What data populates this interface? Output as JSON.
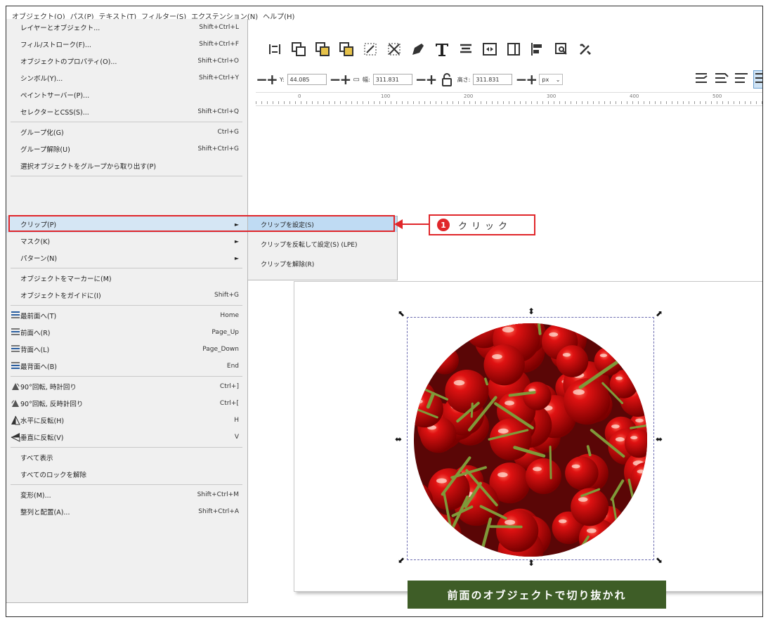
{
  "menubar": [
    "オブジェクト(O)",
    "パス(P)",
    "テキスト(T)",
    "フィルター(S)",
    "エクステンション(N)",
    "ヘルプ(H)"
  ],
  "controls": {
    "y_label": "Y:",
    "y_value": "44.085",
    "w_label": "幅:",
    "w_value": "311.831",
    "h_label": "高さ:",
    "h_value": "311.831",
    "unit": "px"
  },
  "ruler_ticks": [
    "0",
    "100",
    "200",
    "300",
    "400",
    "500"
  ],
  "menu": {
    "items": [
      {
        "label": "レイヤーとオブジェクト...",
        "shortcut": "Shift+Ctrl+L"
      },
      {
        "label": "フィル/ストローク(F)...",
        "shortcut": "Shift+Ctrl+F"
      },
      {
        "label": "オブジェクトのプロパティ(O)...",
        "shortcut": "Shift+Ctrl+O"
      },
      {
        "label": "シンボル(Y)...",
        "shortcut": "Shift+Ctrl+Y"
      },
      {
        "label": "ペイントサーバー(P)...",
        "shortcut": ""
      },
      {
        "label": "セレクターとCSS(S)...",
        "shortcut": "Shift+Ctrl+Q"
      },
      {
        "label": "グループ化(G)",
        "shortcut": "Ctrl+G"
      },
      {
        "label": "グループ解除(U)",
        "shortcut": "Shift+Ctrl+G"
      },
      {
        "label": "選択オブジェクトをグループから取り出す(P)",
        "shortcut": ""
      },
      {
        "label": "クリップ(P)",
        "shortcut": ""
      },
      {
        "label": "マスク(K)",
        "shortcut": ""
      },
      {
        "label": "パターン(N)",
        "shortcut": ""
      },
      {
        "label": "オブジェクトをマーカーに(M)",
        "shortcut": ""
      },
      {
        "label": "オブジェクトをガイドに(I)",
        "shortcut": "Shift+G"
      },
      {
        "label": "最前面へ(T)",
        "shortcut": "Home"
      },
      {
        "label": "前面へ(R)",
        "shortcut": "Page_Up"
      },
      {
        "label": "背面へ(L)",
        "shortcut": "Page_Down"
      },
      {
        "label": "最背面へ(B)",
        "shortcut": "End"
      },
      {
        "label": "90°回転, 時計回り",
        "shortcut": "Ctrl+]"
      },
      {
        "label": "90°回転, 反時計回り",
        "shortcut": "Ctrl+["
      },
      {
        "label": "水平に反転(H)",
        "shortcut": "H"
      },
      {
        "label": "垂直に反転(V)",
        "shortcut": "V"
      },
      {
        "label": "すべて表示",
        "shortcut": ""
      },
      {
        "label": "すべてのロックを解除",
        "shortcut": ""
      },
      {
        "label": "変形(M)...",
        "shortcut": "Shift+Ctrl+M"
      },
      {
        "label": "整列と配置(A)...",
        "shortcut": "Shift+Ctrl+A"
      }
    ]
  },
  "submenu": [
    "クリップを設定(S)",
    "クリップを反転して設定(S) (LPE)",
    "クリップを解除(R)"
  ],
  "callout": {
    "number": "1",
    "text": "クリック"
  },
  "footer_label": "前面のオブジェクトで切り抜かれ",
  "colors": {
    "accent_red": "#e0262a",
    "label_green": "#3e5d27",
    "highlight": "#d5e6f4"
  }
}
